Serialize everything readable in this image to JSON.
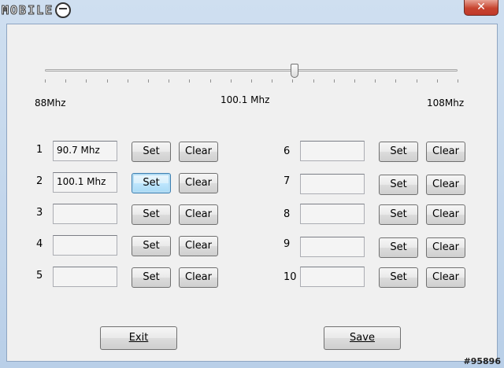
{
  "window": {
    "logo_text": "MOBILE",
    "close_glyph": "✕"
  },
  "slider": {
    "min_label": "88Mhz",
    "max_label": "108Mhz",
    "current_label": "100.1 Mhz",
    "min": 88,
    "max": 108,
    "value": 100.1
  },
  "presets_left": [
    {
      "num": "1",
      "value": "90.7 Mhz",
      "set_label": "Set",
      "clear_label": "Clear"
    },
    {
      "num": "2",
      "value": "100.1 Mhz",
      "set_label": "Set",
      "clear_label": "Clear"
    },
    {
      "num": "3",
      "value": "",
      "set_label": "Set",
      "clear_label": "Clear"
    },
    {
      "num": "4",
      "value": "",
      "set_label": "Set",
      "clear_label": "Clear"
    },
    {
      "num": "5",
      "value": "",
      "set_label": "Set",
      "clear_label": "Clear"
    }
  ],
  "presets_right": [
    {
      "num": "6",
      "value": "",
      "set_label": "Set",
      "clear_label": "Clear"
    },
    {
      "num": "7",
      "value": "",
      "set_label": "Set",
      "clear_label": "Clear"
    },
    {
      "num": "8",
      "value": "",
      "set_label": "Set",
      "clear_label": "Clear"
    },
    {
      "num": "9",
      "value": "",
      "set_label": "Set",
      "clear_label": "Clear"
    },
    {
      "num": "10",
      "value": "",
      "set_label": "Set",
      "clear_label": "Clear"
    }
  ],
  "footer": {
    "exit_label": "Exit",
    "save_label": "Save"
  },
  "watermark": "#95896"
}
